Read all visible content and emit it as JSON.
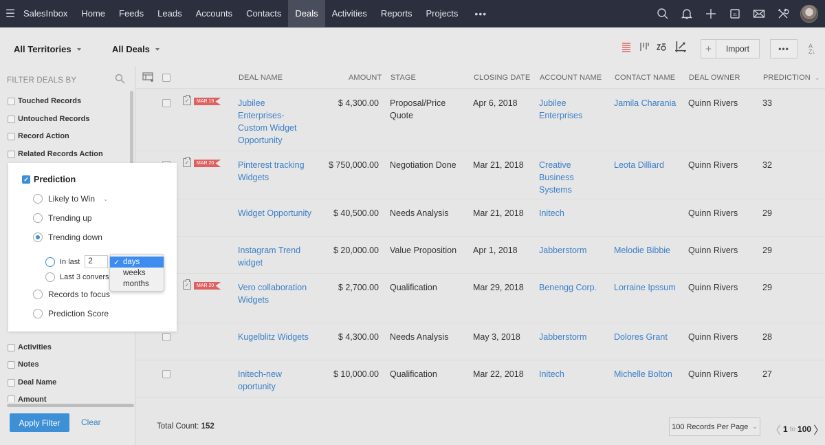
{
  "nav": {
    "brand": "SalesInbox",
    "items": [
      "Home",
      "Feeds",
      "Leads",
      "Accounts",
      "Contacts",
      "Deals",
      "Activities",
      "Reports",
      "Projects"
    ],
    "active": "Deals",
    "more": "•••",
    "right_icons": [
      "search-icon",
      "bell-icon",
      "plus-icon",
      "calendar-icon",
      "mail-icon",
      "tools-icon",
      "avatar"
    ]
  },
  "toolbar": {
    "territory": "All Territories",
    "view": "All Deals",
    "view_icons": [
      "list-view-icon",
      "kanban-view-icon",
      "chart-view-icon",
      "canvas-view-icon"
    ],
    "import_plus": "+",
    "import_label": "Import",
    "more_label": "•••",
    "sort_label_top": "A",
    "sort_label_bottom": "Z↓"
  },
  "sidebar": {
    "title": "FILTER DEALS BY",
    "items_top": [
      "Touched Records",
      "Untouched Records",
      "Record Action",
      "Related Records Action"
    ],
    "items_bottom": [
      "Activities",
      "Notes",
      "Deal Name",
      "Amount"
    ],
    "apply_label": "Apply Filter",
    "clear_label": "Clear"
  },
  "popup": {
    "title": "Prediction",
    "checked": true,
    "options": [
      "Likely to Win",
      "Trending up",
      "Trending down",
      "Records to focus",
      "Prediction Score"
    ],
    "selected_option": "Trending down",
    "sub_options": {
      "in_last_label": "In last",
      "in_last_value": "2",
      "last_conv_label": "Last 3 convers"
    },
    "unit_dropdown": {
      "options": [
        "days",
        "weeks",
        "months"
      ],
      "selected": "days",
      "check": "✓"
    }
  },
  "table": {
    "headers": [
      "DEAL NAME",
      "AMOUNT",
      "STAGE",
      "CLOSING DATE",
      "ACCOUNT NAME",
      "CONTACT NAME",
      "DEAL OWNER",
      "PREDICTION"
    ],
    "sorted_by": "PREDICTION",
    "sort_caret": "⌄",
    "rows": [
      {
        "flag": "MAR 19",
        "task": true,
        "deal": "Jubilee Enterprises-Custom Widget Opportunity",
        "amount": "$ 4,300.00",
        "stage": "Proposal/Price Quote",
        "closing": "Apr 6, 2018",
        "account": "Jubilee Enterprises",
        "contact": "Jamila Charania",
        "owner": "Quinn Rivers",
        "prediction": "33"
      },
      {
        "flag": "MAR 20",
        "task": true,
        "deal": "Pinterest tracking Widgets",
        "amount": "$ 750,000.00",
        "stage": "Negotiation Done",
        "closing": "Mar 21, 2018",
        "account": "Creative Business Systems",
        "contact": "Leota Dilliard",
        "owner": "Quinn Rivers",
        "prediction": "32"
      },
      {
        "flag": "",
        "task": false,
        "deal": "Widget Opportunity",
        "amount": "$ 40,500.00",
        "stage": "Needs Analysis",
        "closing": "Mar 21, 2018",
        "account": "Initech",
        "contact": "",
        "owner": "Quinn Rivers",
        "prediction": "29"
      },
      {
        "flag": "",
        "task": false,
        "deal": "Instagram Trend widget",
        "amount": "$ 20,000.00",
        "stage": "Value Proposition",
        "closing": "Apr 1, 2018",
        "account": "Jabberstorm",
        "contact": "Melodie Bibbie",
        "owner": "Quinn Rivers",
        "prediction": "29"
      },
      {
        "flag": "MAR 20",
        "task": true,
        "deal": "Vero collaboration Widgets",
        "amount": "$ 2,700.00",
        "stage": "Qualification",
        "closing": "Mar 29, 2018",
        "account": "Benengg Corp.",
        "contact": "Lorraine Ipssum",
        "owner": "Quinn Rivers",
        "prediction": "29"
      },
      {
        "flag": "",
        "task": false,
        "deal": "Kugelblitz Widgets",
        "amount": "$ 4,300.00",
        "stage": "Needs Analysis",
        "closing": "May 3, 2018",
        "account": "Jabberstorm",
        "contact": "Dolores Grant",
        "owner": "Quinn Rivers",
        "prediction": "28"
      },
      {
        "flag": "",
        "task": false,
        "deal": "Initech-new oportunity",
        "amount": "$ 10,000.00",
        "stage": "Qualification",
        "closing": "Mar 22, 2018",
        "account": "Initech",
        "contact": "Michelle Bolton",
        "owner": "Quinn Rivers",
        "prediction": "27"
      }
    ]
  },
  "footer": {
    "total_label": "Total Count:",
    "total_value": "152",
    "per_page": "100 Records Per Page",
    "page_from": "1",
    "page_to_label": "to",
    "page_to": "100"
  },
  "colors": {
    "nav_bg": "#2c2f3e",
    "accent_blue": "#3d8fd6",
    "link_blue": "#3b7fc8",
    "flag_red": "#e06060",
    "list_view_active": "#e05a5a"
  }
}
